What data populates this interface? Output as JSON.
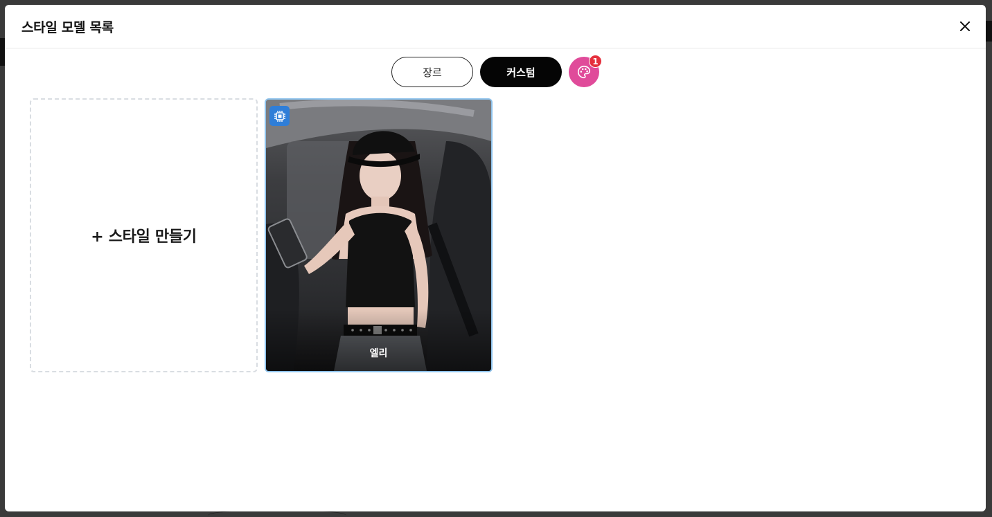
{
  "modal": {
    "title": "스타일 모델 목록"
  },
  "tabs": [
    {
      "label": "장르",
      "active": false
    },
    {
      "label": "커스텀",
      "active": true
    }
  ],
  "palette": {
    "icon": "palette-icon",
    "badge_count": "1",
    "color": "#e04b9a"
  },
  "create_card": {
    "label": "+ 스타일 만들기"
  },
  "models": [
    {
      "name": "엘리",
      "badge_icon": "chip-icon"
    }
  ],
  "colors": {
    "accent_active_tab": "#050505",
    "badge_red": "#e5303d",
    "chip_blue": "#2f7ed8",
    "selected_border": "#8fc3ec"
  }
}
